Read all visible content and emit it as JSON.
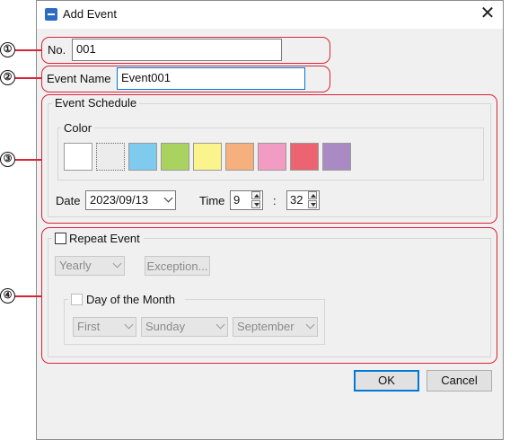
{
  "window": {
    "title": "Add Event",
    "close_glyph": "✕"
  },
  "markers": [
    "①",
    "②",
    "③",
    "④"
  ],
  "number": {
    "label": "No.",
    "value": "001"
  },
  "event_name": {
    "label": "Event Name",
    "value": "Event001"
  },
  "schedule": {
    "group_label": "Event Schedule",
    "color_label": "Color",
    "colors": [
      "#ffffff",
      "#ececec",
      "#7ecbee",
      "#a9d35e",
      "#fbf48d",
      "#f6b07d",
      "#f39cc3",
      "#ec6471",
      "#a98ac3"
    ],
    "date_label": "Date",
    "date_value": "2023/09/13",
    "time_label": "Time",
    "hour": "9",
    "separator": ":",
    "minute": "32"
  },
  "repeat": {
    "label": "Repeat Event",
    "checked": false,
    "frequency": "Yearly",
    "exception_label": "Exception...",
    "day_of_month_label": "Day of the Month",
    "ordinal": "First",
    "weekday": "Sunday",
    "month": "September"
  },
  "buttons": {
    "ok": "OK",
    "cancel": "Cancel"
  },
  "accent": {
    "annotation_red": "#d9233a",
    "focus_blue": "#0078d7"
  }
}
